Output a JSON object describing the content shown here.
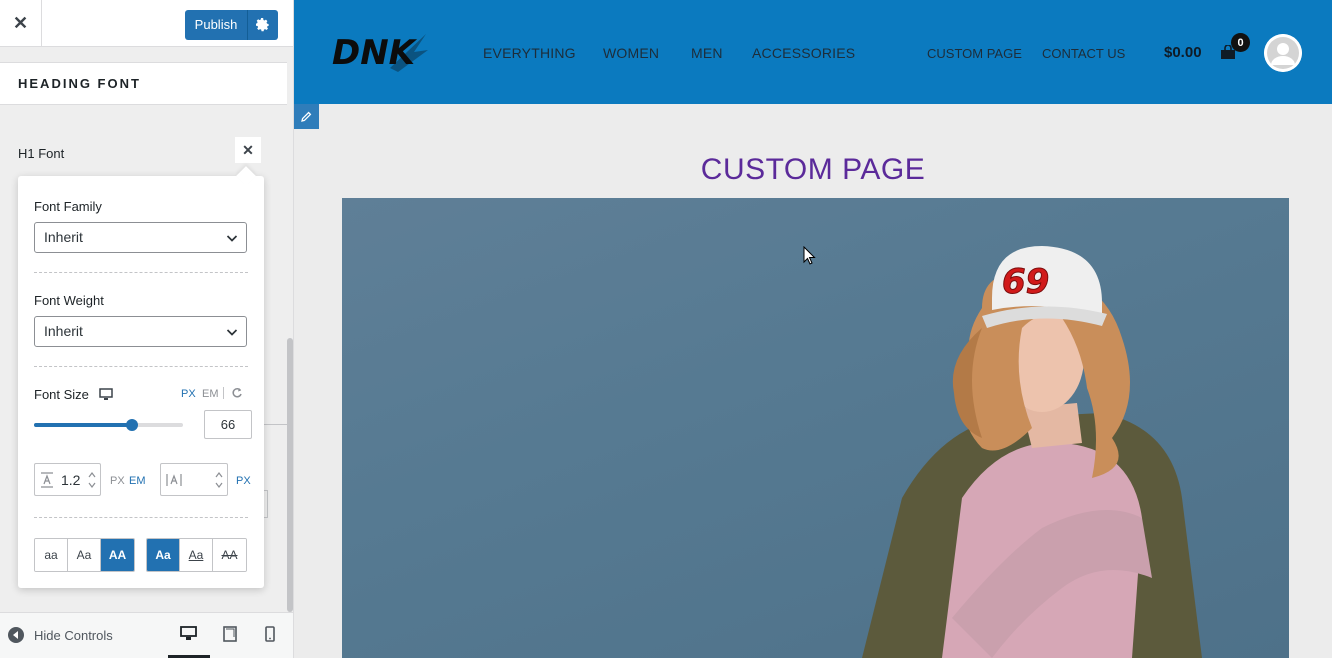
{
  "sidebar": {
    "close_label": "✕",
    "publish_label": "Publish",
    "section_title": "HEADING FONT",
    "h1_font_label": "H1 Font",
    "popover": {
      "font_family_label": "Font Family",
      "font_family_value": "Inherit",
      "font_weight_label": "Font Weight",
      "font_weight_value": "Inherit",
      "font_size_label": "Font Size",
      "unit_px": "PX",
      "unit_em": "EM",
      "font_size_value": "66",
      "font_size_slider_fraction": 0.66,
      "line_height_value": "1.2",
      "line_height_unit_px": "PX",
      "line_height_unit_em": "EM",
      "letter_spacing_value": "",
      "letter_spacing_unit": "PX",
      "transform_buttons": [
        "aa",
        "Aa",
        "AA"
      ],
      "decoration_buttons": [
        "Aa",
        "Aa",
        "AA"
      ]
    },
    "footer": {
      "hide_controls_label": "Hide Controls"
    }
  },
  "preview": {
    "logo_text": "DNK",
    "nav_left": [
      "EVERYTHING",
      "WOMEN",
      "MEN",
      "ACCESSORIES"
    ],
    "nav_right": [
      "CUSTOM PAGE",
      "CONTACT US"
    ],
    "cart_total": "$0.00",
    "cart_count": "0",
    "page_title": "CUSTOM PAGE",
    "cap_number": "69"
  },
  "colors": {
    "header_blue": "#0b7abf",
    "accent": "#2271b1",
    "title_purple": "#5b2a9a"
  },
  "icons": [
    "close-icon",
    "gear-icon",
    "chevron-down-icon",
    "desktop-icon",
    "reset-icon",
    "line-height-icon",
    "letter-spacing-icon",
    "spinner-icon",
    "cart-icon",
    "user-avatar-icon",
    "pencil-icon",
    "mouse-cursor-icon",
    "tablet-icon",
    "mobile-icon",
    "collapse-arrow-icon"
  ]
}
